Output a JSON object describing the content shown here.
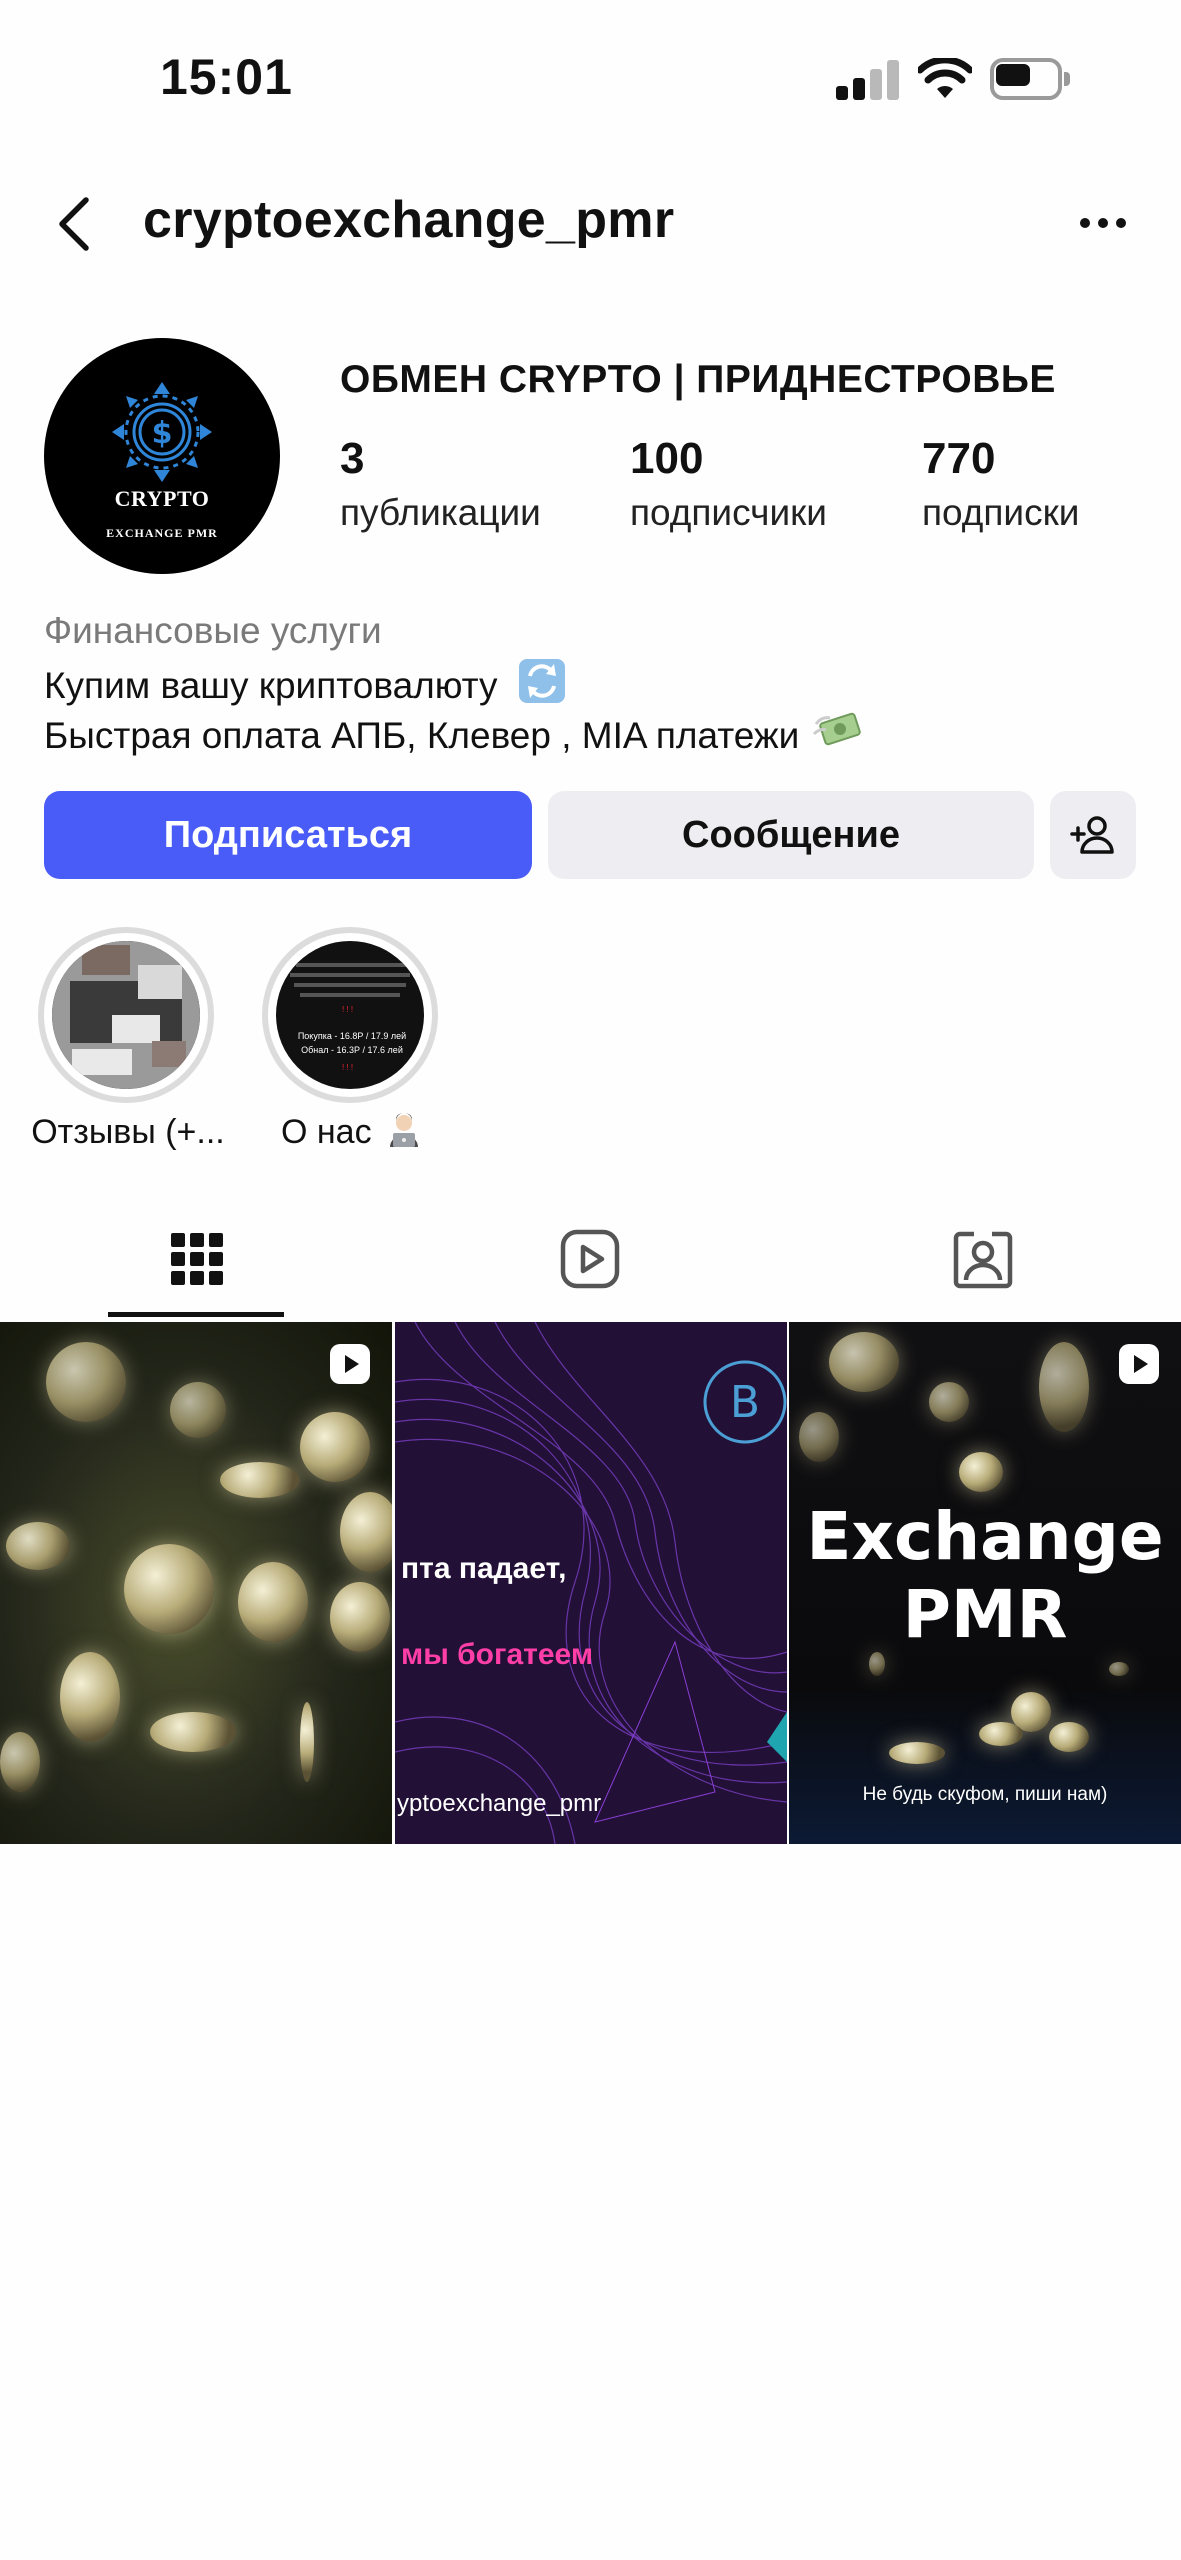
{
  "status_bar": {
    "time": "15:01"
  },
  "nav": {
    "username": "cryptoexchange_pmr"
  },
  "profile": {
    "avatar_text": "CRYPTO",
    "avatar_subtext": "EXCHANGE PMR",
    "display_name": "ОБМЕН CRYPTO | ПРИДНЕСТРОВЬЕ",
    "stats": [
      {
        "value": "3",
        "label": "публикации"
      },
      {
        "value": "100",
        "label": "подписчики"
      },
      {
        "value": "770",
        "label": "подписки"
      }
    ],
    "category": "Финансовые услуги",
    "bio_line1": "Купим вашу криптовалюту",
    "bio_line2": "Быстрая оплата АПБ, Клевер , MIA платежи"
  },
  "actions": {
    "follow_label": "Подписаться",
    "message_label": "Сообщение"
  },
  "highlights": [
    {
      "label": "Отзывы (+..."
    },
    {
      "label": "О нас",
      "cover_line1": "Покупка - 16.8Р / 17.9 лей",
      "cover_line2": "Обнал - 16.3Р / 17.6 лей"
    }
  ],
  "tabs": [
    {
      "icon": "grid-icon"
    },
    {
      "icon": "reels-icon"
    },
    {
      "icon": "tagged-icon"
    }
  ],
  "posts": [
    {
      "type": "reel"
    },
    {
      "line1": "пта падает,",
      "line2": "мы богатеем",
      "handle": "yptoexchange_pmr"
    },
    {
      "type": "reel",
      "title_line1": "Exchange",
      "title_line2": "PMR",
      "caption": "Не будь скуфом, пиши нам)"
    }
  ],
  "colors": {
    "accent": "#4a5cf7",
    "secondary_button": "#eeeef2"
  }
}
